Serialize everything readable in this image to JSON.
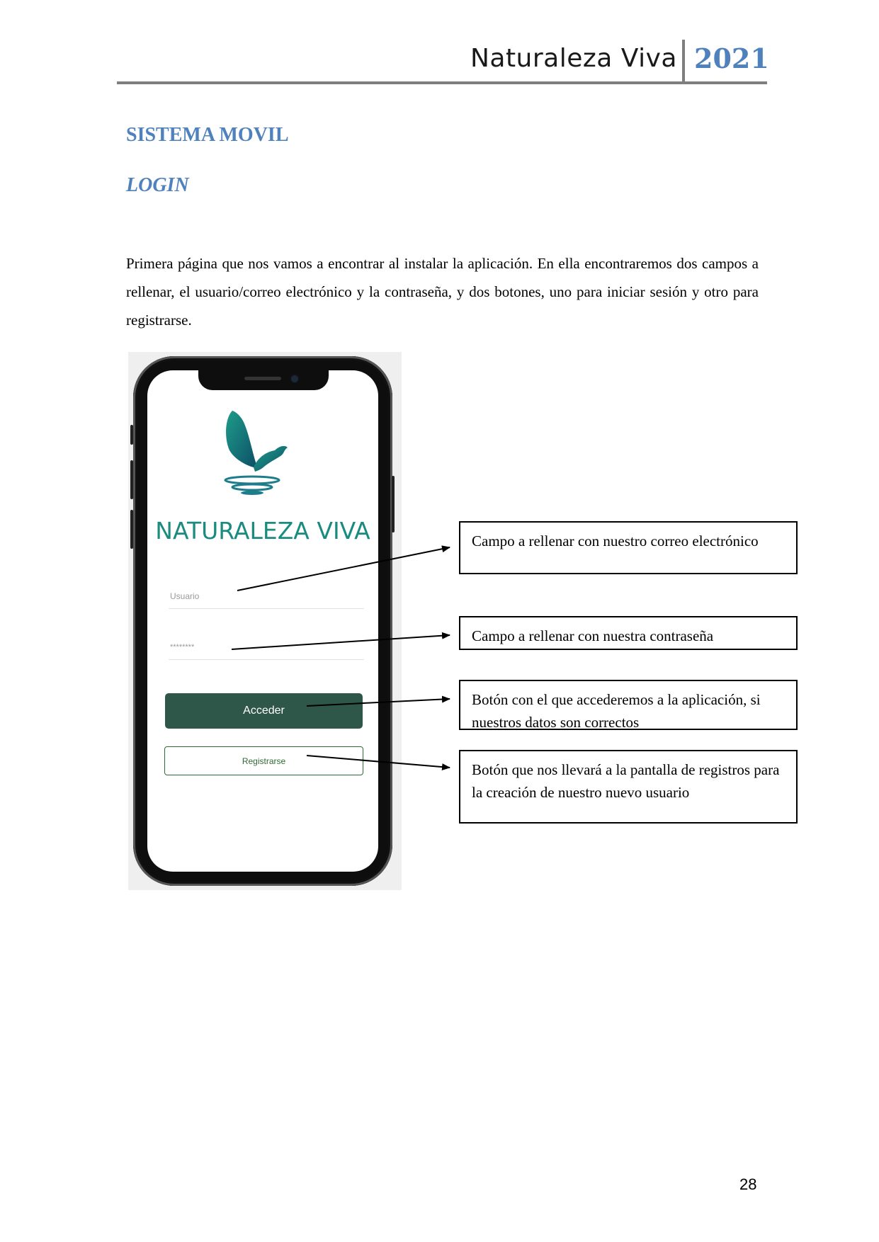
{
  "header": {
    "title": "Naturaleza Viva",
    "year": "2021"
  },
  "section_title": "SISTEMA MOVIL",
  "subsection_title": "LOGIN",
  "body_paragraph": "Primera página que nos vamos a encontrar al instalar la aplicación. En ella encontraremos dos campos a rellenar, el usuario/correo electrónico y la contraseña, y dos botones, uno para iniciar sesión y otro para registrarse.",
  "phone": {
    "brand_name": "NATURALEZA VIVA",
    "username_placeholder": "Usuario",
    "password_placeholder": "********",
    "login_button": "Acceder",
    "register_button": "Registrarse"
  },
  "callouts": [
    "Campo a rellenar con nuestro correo electrónico",
    "Campo a rellenar con nuestra contraseña",
    "Botón con el que accederemos a la aplicación, si nuestros datos son correctos",
    "Botón que nos llevará a la pantalla de registros para la creación de nuestro nuevo usuario"
  ],
  "page_number": "28",
  "colors": {
    "heading_blue": "#4f81bd",
    "brand_teal": "#1a8c7f",
    "button_green": "#2e5749"
  }
}
